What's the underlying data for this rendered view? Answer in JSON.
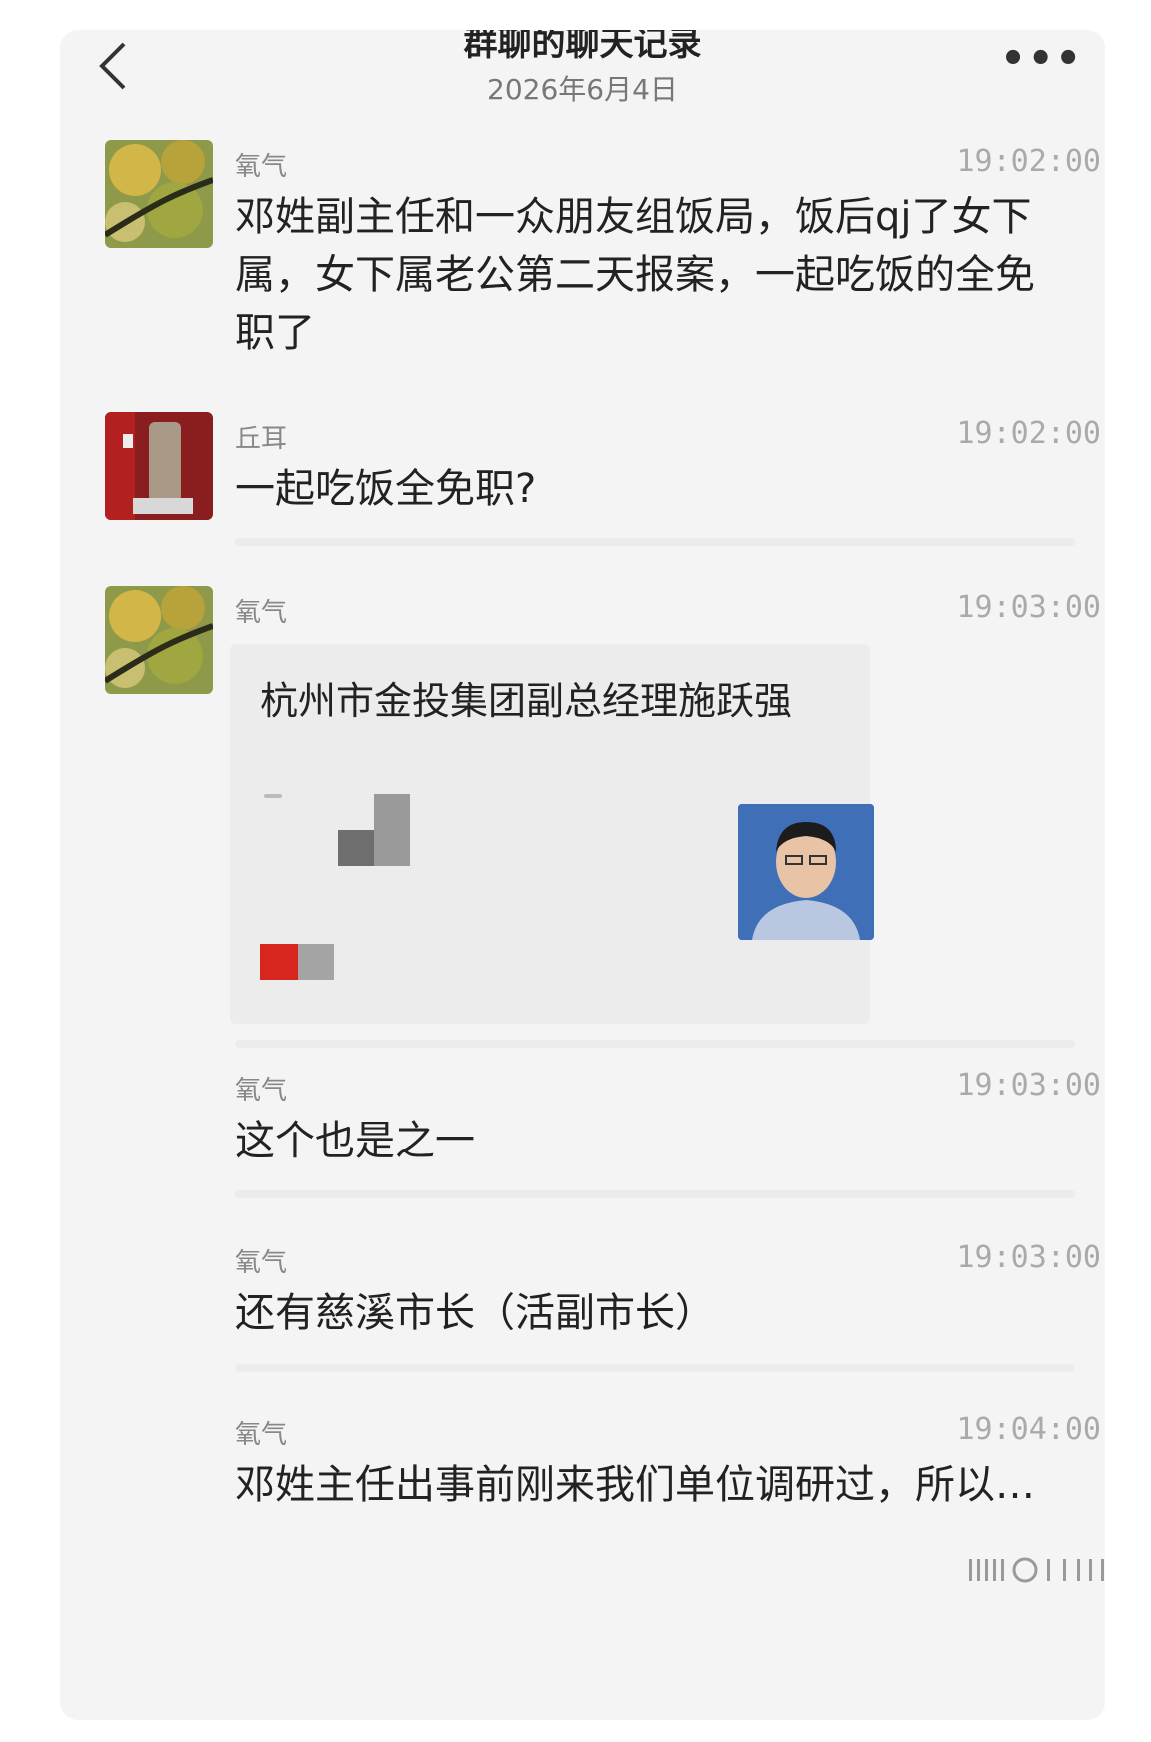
{
  "header": {
    "title": "群聊的聊天记录",
    "date": "2026年6月4日"
  },
  "messages": [
    {
      "sender": "氧气",
      "time": "19:02:00",
      "text": "邓姓副主任和一众朋友组饭局，饭后qj了女下属，女下属老公第二天报案，一起吃饭的全免职了"
    },
    {
      "sender": "丘耳",
      "time": "19:02:00",
      "text": "一起吃饭全免职?"
    },
    {
      "sender": "氧气",
      "time": "19:03:00",
      "card_title": "杭州市金投集团副总经理施跃强"
    },
    {
      "sender": "氧气",
      "time": "19:03:00",
      "text": "这个也是之一"
    },
    {
      "sender": "氧气",
      "time": "19:03:00",
      "text": "还有慈溪市长（活副市长）"
    },
    {
      "sender": "氧气",
      "time": "19:04:00",
      "text": "邓姓主任出事前刚来我们单位调研过，所以…"
    }
  ],
  "colors": {
    "background": "#f4f4f4",
    "card_photo_bg": "#3e6fb7",
    "card_accent_red": "#d8261e"
  },
  "icons": [
    "back-icon",
    "more-icon"
  ]
}
